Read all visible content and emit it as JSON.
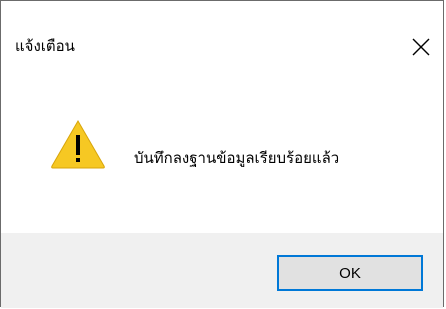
{
  "dialog": {
    "title": "แจ้งเตือน",
    "message": "บันทึกลงฐานข้อมูลเรียบร้อยแล้ว",
    "ok_label": "OK",
    "icon": "warning-icon",
    "close_icon": "close-icon"
  },
  "colors": {
    "accent": "#0078d7",
    "button_face": "#e1e1e1",
    "footer": "#f0f0f0",
    "warning_fill": "#f6c823"
  }
}
